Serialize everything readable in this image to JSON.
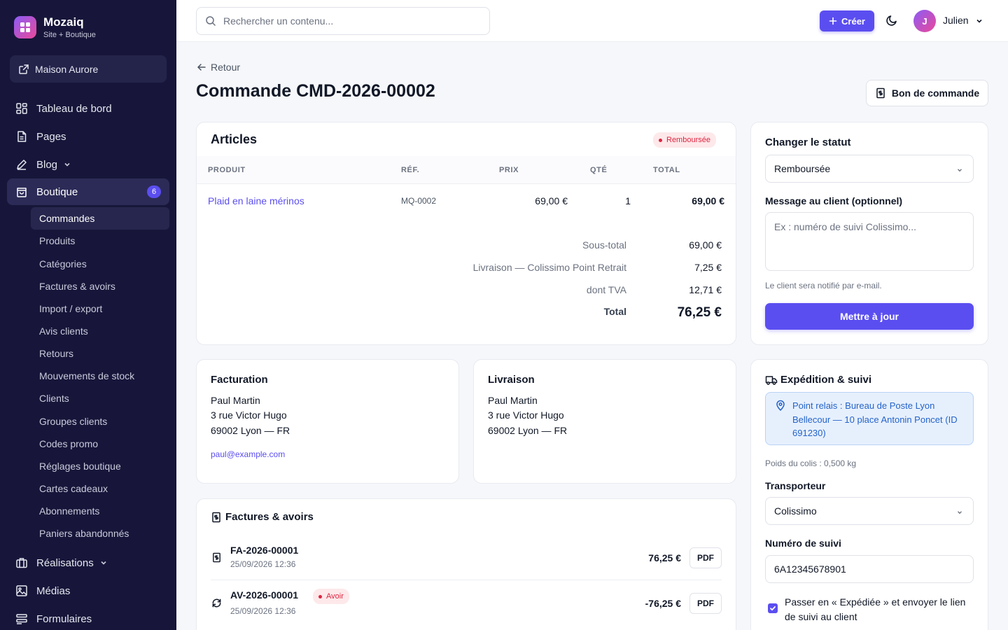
{
  "brand": {
    "name": "Mozaiq",
    "subtitle": "Site + Boutique"
  },
  "site_link": {
    "label": "Maison Aurore"
  },
  "nav": {
    "dashboard": "Tableau de bord",
    "pages": "Pages",
    "blog": "Blog",
    "shop": "Boutique",
    "shop_badge": "6",
    "projects": "Réalisations",
    "media": "Médias",
    "forms": "Formulaires"
  },
  "shop_submenu": [
    "Commandes",
    "Produits",
    "Catégories",
    "Factures & avoirs",
    "Import / export",
    "Avis clients",
    "Retours",
    "Mouvements de stock",
    "Clients",
    "Groupes clients",
    "Codes promo",
    "Réglages boutique",
    "Cartes cadeaux",
    "Abonnements",
    "Paniers abandonnés"
  ],
  "topbar": {
    "search_placeholder": "Rechercher un contenu...",
    "create_label": "Créer",
    "user_initial": "J",
    "user_name": "Julien"
  },
  "page": {
    "back_label": "Retour",
    "title": "Commande CMD-2026-00002",
    "purchase_order_label": "Bon de commande"
  },
  "articles": {
    "title": "Articles",
    "status_badge": "Remboursée",
    "columns": {
      "product": "PRODUIT",
      "ref": "RÉF.",
      "price": "PRIX",
      "qty": "QTÉ",
      "total": "TOTAL"
    },
    "row": {
      "product": "Plaid en laine mérinos",
      "ref": "MQ-0002",
      "price": "69,00 €",
      "qty": "1",
      "total": "69,00 €"
    },
    "summary": {
      "subtotal_label": "Sous-total",
      "subtotal": "69,00 €",
      "shipping_label": "Livraison — Colissimo Point Retrait",
      "shipping": "7,25 €",
      "vat_label": "dont TVA",
      "vat": "12,71 €",
      "total_label": "Total",
      "total": "76,25 €"
    }
  },
  "billing": {
    "title": "Facturation",
    "name": "Paul Martin",
    "street": "3 rue Victor Hugo",
    "city": "69002 Lyon — FR",
    "email": "paul@example.com"
  },
  "delivery": {
    "title": "Livraison",
    "name": "Paul Martin",
    "street": "3 rue Victor Hugo",
    "city": "69002 Lyon — FR"
  },
  "invoices": {
    "title": "Factures & avoirs",
    "pdf_label": "PDF",
    "items": [
      {
        "number": "FA-2026-00001",
        "date": "25/09/2026 12:36",
        "amount": "76,25 €"
      },
      {
        "number": "AV-2026-00001",
        "badge": "Avoir",
        "date": "25/09/2026 12:36",
        "amount": "-76,25 €"
      }
    ]
  },
  "status_panel": {
    "title": "Changer le statut",
    "current_status": "Remboursée",
    "message_label": "Message au client (optionnel)",
    "message_placeholder": "Ex : numéro de suivi Colissimo...",
    "help": "Le client sera notifié par e-mail.",
    "submit_label": "Mettre à jour"
  },
  "shipping_panel": {
    "title": "Expédition & suivi",
    "relay": "Point relais : Bureau de Poste Lyon Bellecour — 10 place Antonin Poncet (ID 691230)",
    "weight": "Poids du colis : 0,500 kg",
    "carrier_label": "Transporteur",
    "carrier": "Colissimo",
    "tracking_label": "Numéro de suivi",
    "tracking_number": "6A12345678901",
    "notify_label": "Passer en « Expédiée » et envoyer le lien de suivi au client",
    "notify_checked": true
  },
  "colors": {
    "accent": "#5b4ef0",
    "sidebar": "#17163a",
    "danger": "#dc2640",
    "info": "#2563c9"
  }
}
